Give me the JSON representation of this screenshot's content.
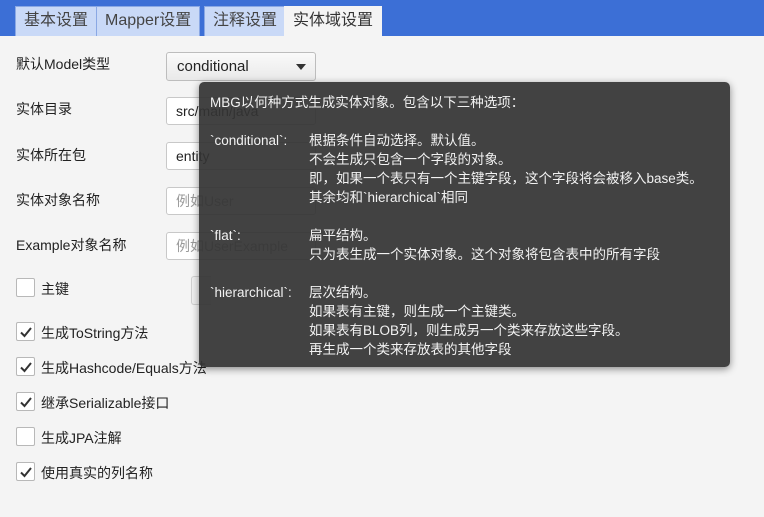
{
  "tabs": [
    {
      "label": "基本设置",
      "active": false
    },
    {
      "label": "Mapper设置",
      "active": false
    },
    {
      "label": "注释设置",
      "active": false
    },
    {
      "label": "实体域设置",
      "active": true
    }
  ],
  "form": {
    "model_type": {
      "label": "默认Model类型",
      "value": "conditional"
    },
    "entity_dir": {
      "label": "实体目录",
      "value": "src/main/java"
    },
    "entity_package": {
      "label": "实体所在包",
      "value": "entity"
    },
    "entity_name": {
      "label": "实体对象名称",
      "placeholder": "例如User"
    },
    "example_name": {
      "label": "Example对象名称",
      "placeholder": "例如UserExample"
    },
    "primary_key": {
      "label": "主键",
      "checked": false
    }
  },
  "checkboxes": [
    {
      "label": "生成ToString方法",
      "checked": true
    },
    {
      "label": "生成Hashcode/Equals方法",
      "checked": true
    },
    {
      "label": "继承Serializable接口",
      "checked": true
    },
    {
      "label": "生成JPA注解",
      "checked": false
    },
    {
      "label": "使用真实的列名称",
      "checked": true
    }
  ],
  "tooltip": {
    "intro": "MBG以何种方式生成实体对象。包含以下三种选项：",
    "options": [
      {
        "key": "`conditional`:",
        "lines": [
          "根据条件自动选择。默认值。",
          "不会生成只包含一个字段的对象。",
          "即，如果一个表只有一个主键字段，这个字段将会被移入base类。",
          "其余均和`hierarchical`相同"
        ]
      },
      {
        "key": "`flat`:",
        "lines": [
          "扁平结构。",
          "只为表生成一个实体对象。这个对象将包含表中的所有字段"
        ]
      },
      {
        "key": "`hierarchical`:",
        "lines": [
          "层次结构。",
          "如果表有主键，则生成一个主键类。",
          "如果表有BLOB列，则生成另一个类来存放这些字段。",
          "再生成一个类来存放表的其他字段"
        ]
      }
    ]
  }
}
